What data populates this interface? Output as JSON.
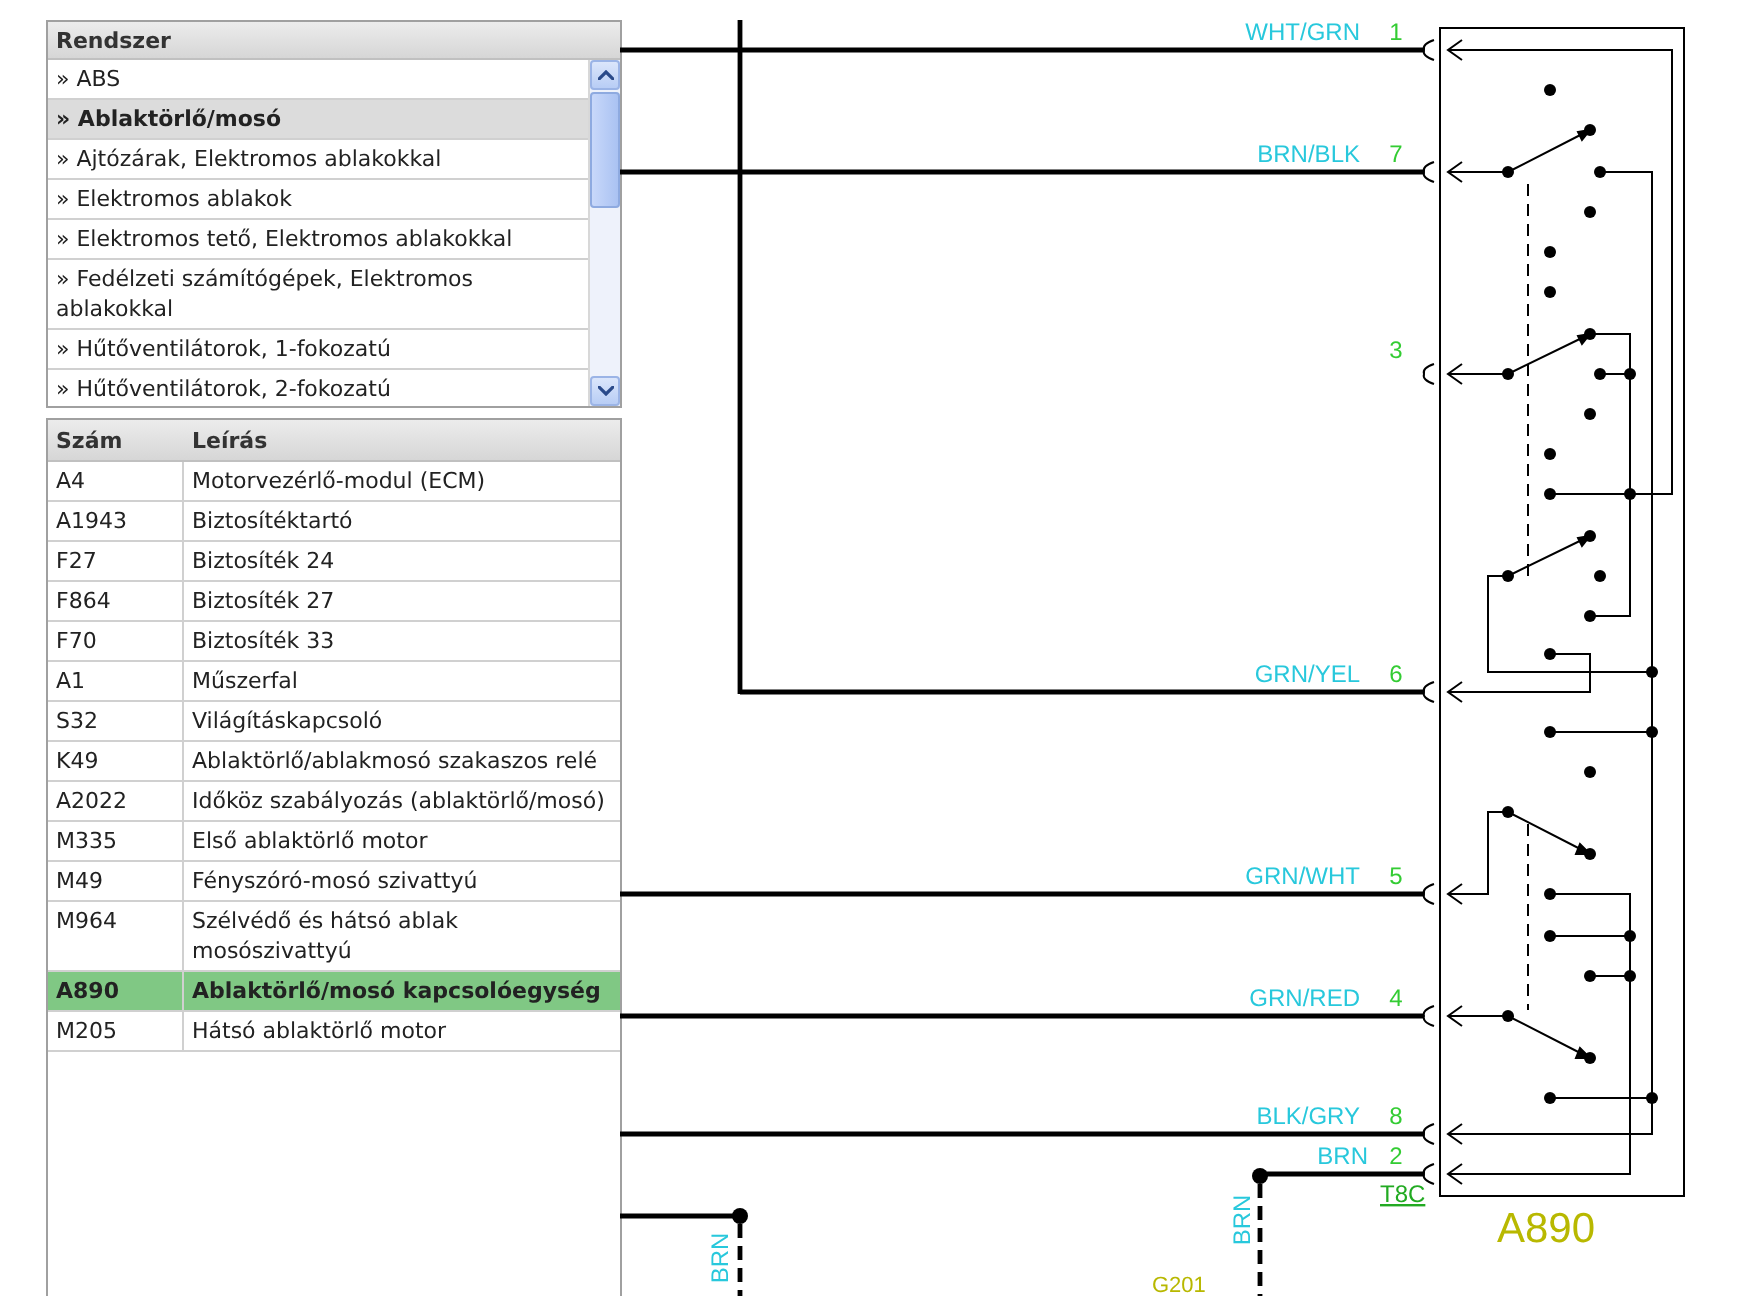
{
  "system_list": {
    "title": "Rendszer",
    "items": [
      {
        "label": "» ABS",
        "selected": false
      },
      {
        "label": "» Ablaktörlő/mosó",
        "selected": true
      },
      {
        "label": "» Ajtózárak, Elektromos ablakokkal",
        "selected": false
      },
      {
        "label": "» Elektromos ablakok",
        "selected": false
      },
      {
        "label": "» Elektromos tető, Elektromos ablakokkal",
        "selected": false
      },
      {
        "label": "» Fedélzeti számítógépek, Elektromos ablakokkal",
        "selected": false
      },
      {
        "label": "» Hűtőventilátorok, 1-fokozatú",
        "selected": false
      },
      {
        "label": "» Hűtőventilátorok, 2-fokozatú",
        "selected": false
      }
    ]
  },
  "components_table": {
    "columns": [
      "Szám",
      "Leírás"
    ],
    "rows": [
      {
        "code": "A4",
        "description": "Motorvezérlő-modul (ECM)",
        "selected": false
      },
      {
        "code": "A1943",
        "description": "Biztosítéktartó",
        "selected": false
      },
      {
        "code": "F27",
        "description": "Biztosíték 24",
        "selected": false
      },
      {
        "code": "F864",
        "description": "Biztosíték 27",
        "selected": false
      },
      {
        "code": "F70",
        "description": "Biztosíték 33",
        "selected": false
      },
      {
        "code": "A1",
        "description": "Műszerfal",
        "selected": false
      },
      {
        "code": "S32",
        "description": "Világításkapcsoló",
        "selected": false
      },
      {
        "code": "K49",
        "description": "Ablaktörlő/ablakmosó szakaszos relé",
        "selected": false
      },
      {
        "code": "A2022",
        "description": "Időköz szabályozás (ablaktörlő/mosó)",
        "selected": false
      },
      {
        "code": "M335",
        "description": "Első ablaktörlő motor",
        "selected": false
      },
      {
        "code": "M49",
        "description": "Fényszóró-mosó szivattyú",
        "selected": false
      },
      {
        "code": "M964",
        "description": "Szélvédő és hátsó ablak mosószivattyú",
        "selected": false
      },
      {
        "code": "A890",
        "description": "Ablaktörlő/mosó kapcsolóegység",
        "selected": true
      },
      {
        "code": "M205",
        "description": "Hátsó ablaktörlő motor",
        "selected": false
      }
    ]
  },
  "diagram": {
    "pins": [
      {
        "wire": "WHT/GRN",
        "pin": "1"
      },
      {
        "wire": "BRN/BLK",
        "pin": "7"
      },
      {
        "pin": "3"
      },
      {
        "wire": "GRN/YEL",
        "pin": "6"
      },
      {
        "wire": "GRN/WHT",
        "pin": "5"
      },
      {
        "wire": "GRN/RED",
        "pin": "4"
      },
      {
        "wire": "BLK/GRY",
        "pin": "8"
      },
      {
        "wire": "BRN",
        "pin": "2"
      }
    ],
    "connector": "T8C",
    "component": "A890",
    "vertical_wire_labels": [
      "BRN",
      "BRN"
    ],
    "ground": "G201"
  }
}
